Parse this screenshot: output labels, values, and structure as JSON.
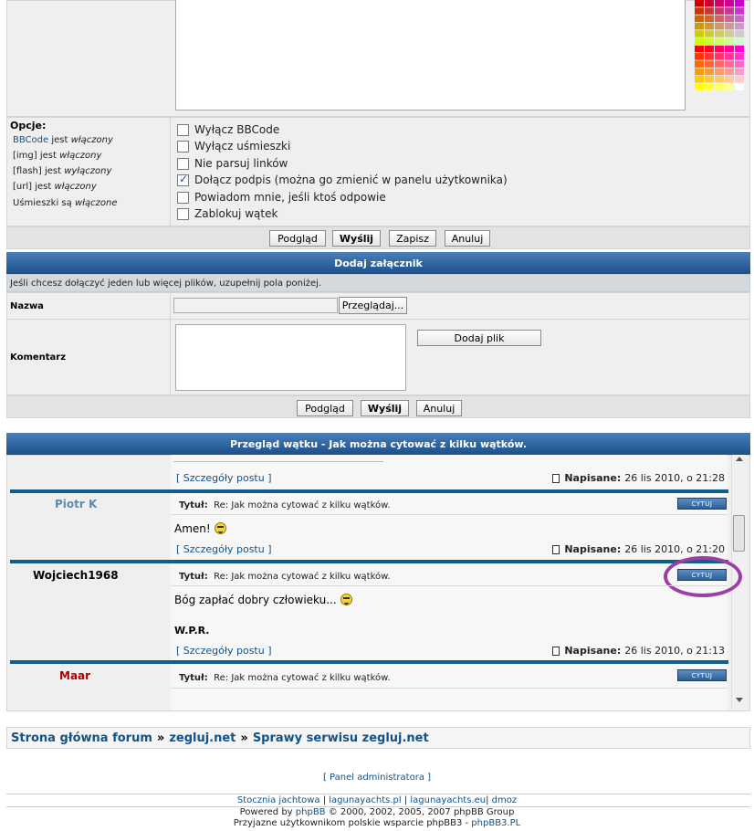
{
  "options": {
    "label": "Opcje:",
    "lines": [
      {
        "name": "BBCode",
        "mid": " jest ",
        "state": "włączony"
      },
      {
        "name": "[img]",
        "mid": " jest ",
        "state": "włączony"
      },
      {
        "name": "[flash]",
        "mid": " jest ",
        "state": "wyłączony"
      },
      {
        "name": "[url]",
        "mid": " jest ",
        "state": "włączony"
      },
      {
        "name": "Uśmieszki",
        "mid": " są ",
        "state": "włączone"
      }
    ],
    "checkboxes": [
      {
        "label": "Wyłącz BBCode",
        "checked": false
      },
      {
        "label": "Wyłącz uśmieszki",
        "checked": false
      },
      {
        "label": "Nie parsuj linków",
        "checked": false
      },
      {
        "label": "Dołącz podpis (można go zmienić w panelu użytkownika)",
        "checked": true
      },
      {
        "label": "Powiadom mnie, jeśli ktoś odpowie",
        "checked": false
      },
      {
        "label": "Zablokuj wątek",
        "checked": false
      }
    ]
  },
  "buttons": {
    "preview": "Podgląd",
    "submit": "Wyślij",
    "save": "Zapisz",
    "cancel": "Anuluj",
    "browse": "Przeglądaj...",
    "add_file": "Dodaj plik"
  },
  "attachment": {
    "header": "Dodaj załącznik",
    "info": "Jeśli chcesz dołączyć jeden lub więcej plików, uzupełnij pola poniżej.",
    "name_label": "Nazwa",
    "comment_label": "Komentarz"
  },
  "review": {
    "header": "Przegląd wątku - Jak można cytować z kilku wątków.",
    "details_link": "[ Szczegóły postu ]",
    "posted_label": "Napisane:",
    "title_label": "Tytuł:",
    "quote_label": "CYTUJ",
    "posts": [
      {
        "author": "",
        "title": "",
        "body": "",
        "date": "26 lis 2010, o 21:28"
      },
      {
        "author": "Piotr K",
        "title": "Re: Jak można cytować z kilku wątków.",
        "body": "Amen!",
        "date": "26 lis 2010, o 21:20"
      },
      {
        "author": "Wojciech1968",
        "title": "Re: Jak można cytować z kilku wątków.",
        "body": "Bóg zapłać dobry człowieku...",
        "signature": "W.P.R.",
        "date": "26 lis 2010, o 21:13"
      },
      {
        "author": "Maar",
        "title": "Re: Jak można cytować z kilku wątków.",
        "body": "",
        "date": ""
      }
    ],
    "author_colors": {
      "piotr": "#5b8caf",
      "wojciech": "#000000",
      "maar": "#aa0000"
    },
    "highlight_color": "#9b3fa5"
  },
  "breadcrumb": {
    "items": [
      "Strona główna forum",
      "zegluj.net",
      "Sprawy serwisu zegluj.net"
    ],
    "sep": "»"
  },
  "footer": {
    "admin_link": "[ Panel administratora ]",
    "links": [
      "Stocznia jachtowa",
      "lagunayachts.pl",
      "lagunayachts.eu",
      "dmoz"
    ],
    "powered_prefix": "Powered by ",
    "powered_link": "phpBB",
    "powered_suffix": " © 2000, 2002, 2005, 2007 phpBB Group",
    "support_prefix": "Przyjazne użytkownikom polskie wsparcie phpBB3 - ",
    "support_link": "phpBB3.PL"
  }
}
